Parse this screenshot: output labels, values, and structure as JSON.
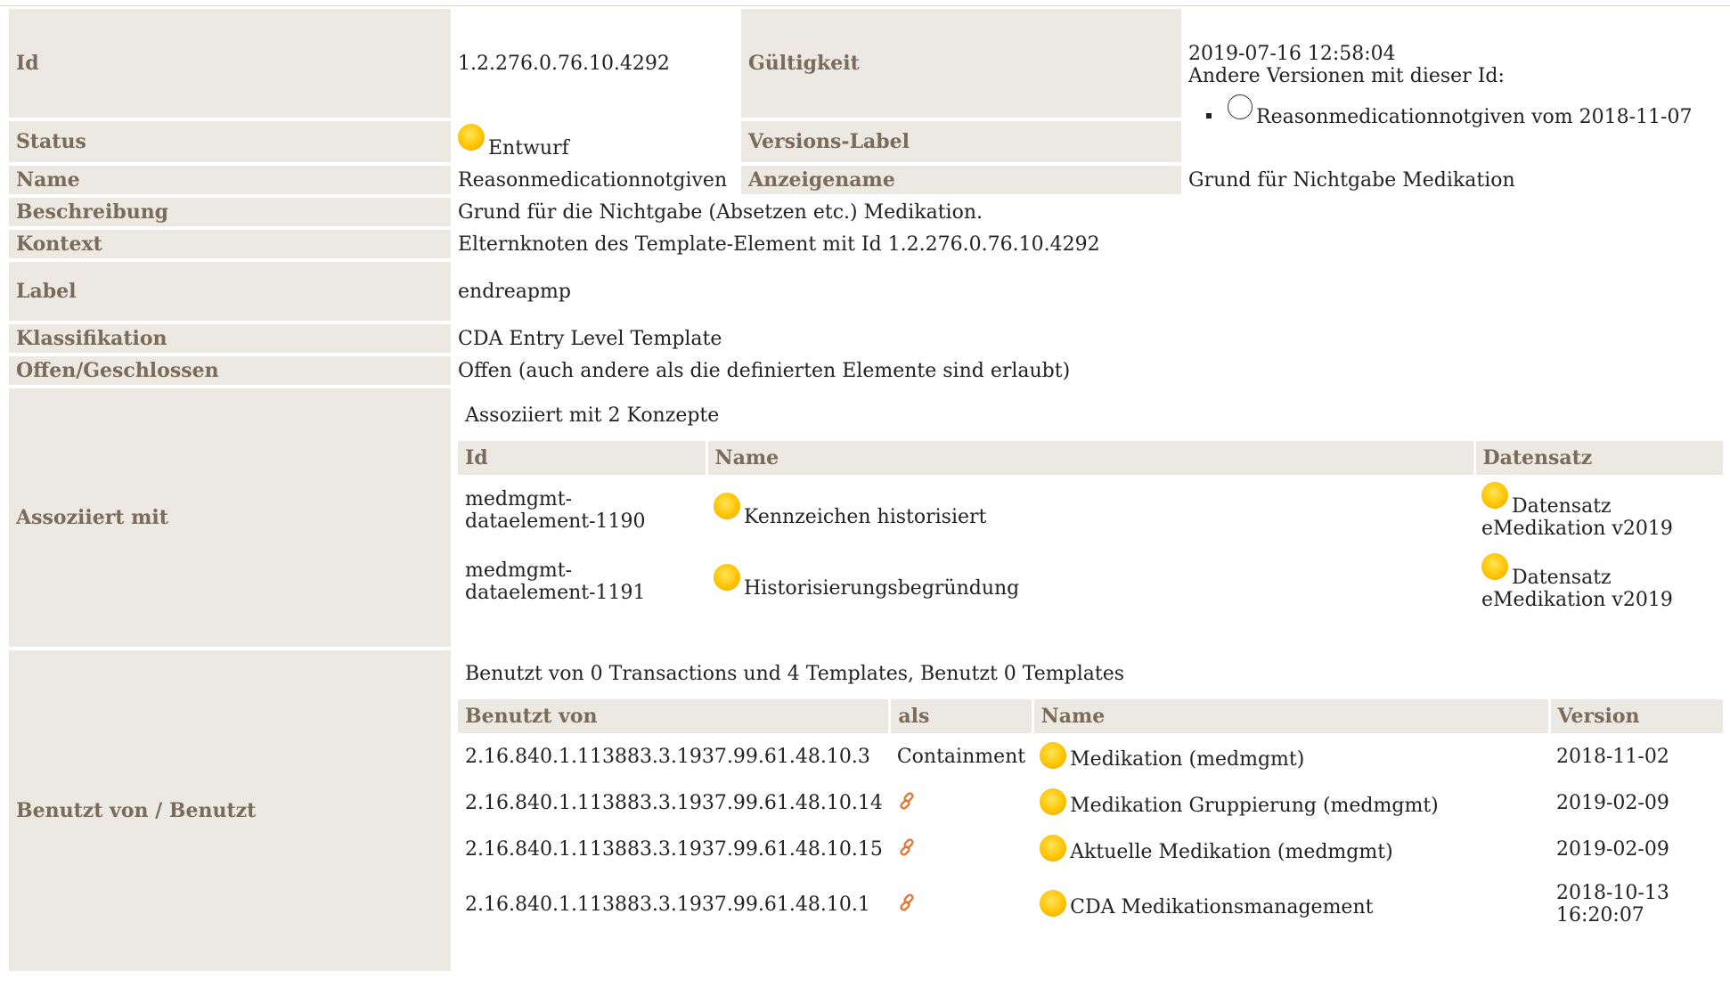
{
  "rows": {
    "id": {
      "label": "Id",
      "value": "1.2.276.0.76.10.4292"
    },
    "validity": {
      "label": "Gültigkeit",
      "date": "2019-07-16 12:58:04",
      "other_versions_label": "Andere Versionen mit dieser Id:",
      "other_versions": [
        "Reasonmedicationnotgiven vom 2018-11-07"
      ]
    },
    "status": {
      "label": "Status",
      "value": "Entwurf",
      "icon": "yellow-ball-icon",
      "color": "#ffc400"
    },
    "version_label": {
      "label": "Versions-Label",
      "value": ""
    },
    "name": {
      "label": "Name",
      "value": "Reasonmedicationnotgiven"
    },
    "display_name": {
      "label": "Anzeigename",
      "value": "Grund für Nichtgabe Medikation"
    },
    "description": {
      "label": "Beschreibung",
      "value": "Grund für die Nichtgabe (Absetzen etc.) Medikation."
    },
    "context": {
      "label": "Kontext",
      "value": "Elternknoten des Template-Element mit Id 1.2.276.0.76.10.4292"
    },
    "label_row": {
      "label": "Label",
      "value": "endreapmp"
    },
    "classification": {
      "label": "Klassifikation",
      "value": "CDA Entry Level Template"
    },
    "open_closed": {
      "label": "Offen/Geschlossen",
      "value": "Offen (auch andere als die definierten Elemente sind erlaubt)"
    },
    "associated": {
      "label": "Assoziiert mit",
      "caption": "Assoziiert mit 2 Konzepte",
      "headers": {
        "id": "Id",
        "name": "Name",
        "dataset": "Datensatz"
      },
      "items": [
        {
          "id": "medmgmt-dataelement-1190",
          "name": "Kennzeichen historisiert",
          "dataset": "Datensatz eMedikation v2019"
        },
        {
          "id": "medmgmt-dataelement-1191",
          "name": "Historisierungsbegründung",
          "dataset": "Datensatz eMedikation v2019"
        }
      ]
    },
    "used_by": {
      "label": "Benutzt von / Benutzt",
      "caption": "Benutzt von 0 Transactions und 4 Templates, Benutzt 0 Templates",
      "headers": {
        "used_by": "Benutzt von",
        "as": "als",
        "name": "Name",
        "version": "Version"
      },
      "items": [
        {
          "used_by": "2.16.840.1.113883.3.1937.99.61.48.10.3",
          "as": "Containment",
          "as_icon": "",
          "name": "Medikation (medmgmt)",
          "version": "2018-11-02"
        },
        {
          "used_by": "2.16.840.1.113883.3.1937.99.61.48.10.14",
          "as": "",
          "as_icon": "link-icon",
          "name": "Medikation Gruppierung (medmgmt)",
          "version": "2019-02-09"
        },
        {
          "used_by": "2.16.840.1.113883.3.1937.99.61.48.10.15",
          "as": "",
          "as_icon": "link-icon",
          "name": "Aktuelle Medikation (medmgmt)",
          "version": "2019-02-09"
        },
        {
          "used_by": "2.16.840.1.113883.3.1937.99.61.48.10.1",
          "as": "",
          "as_icon": "link-icon",
          "name": "CDA Medikationsmanagement",
          "version": "2018-10-13 16:20:07"
        }
      ]
    }
  },
  "colors": {
    "label_bg": "#ece8e2",
    "label_text": "#7a6b5a",
    "link_icon": "#e8762c"
  }
}
